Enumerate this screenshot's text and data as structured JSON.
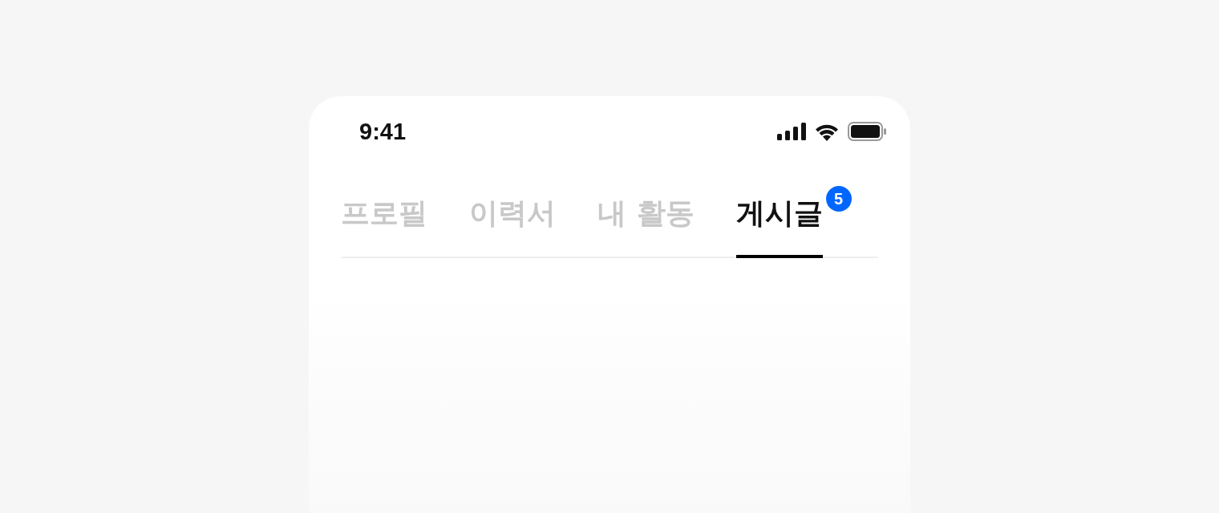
{
  "status_bar": {
    "time": "9:41"
  },
  "tabs": [
    {
      "label": "프로필",
      "selected": false
    },
    {
      "label": "이력서",
      "selected": false
    },
    {
      "label": "내 활동",
      "selected": false
    },
    {
      "label": "게시글",
      "selected": true,
      "badge": "5"
    }
  ]
}
